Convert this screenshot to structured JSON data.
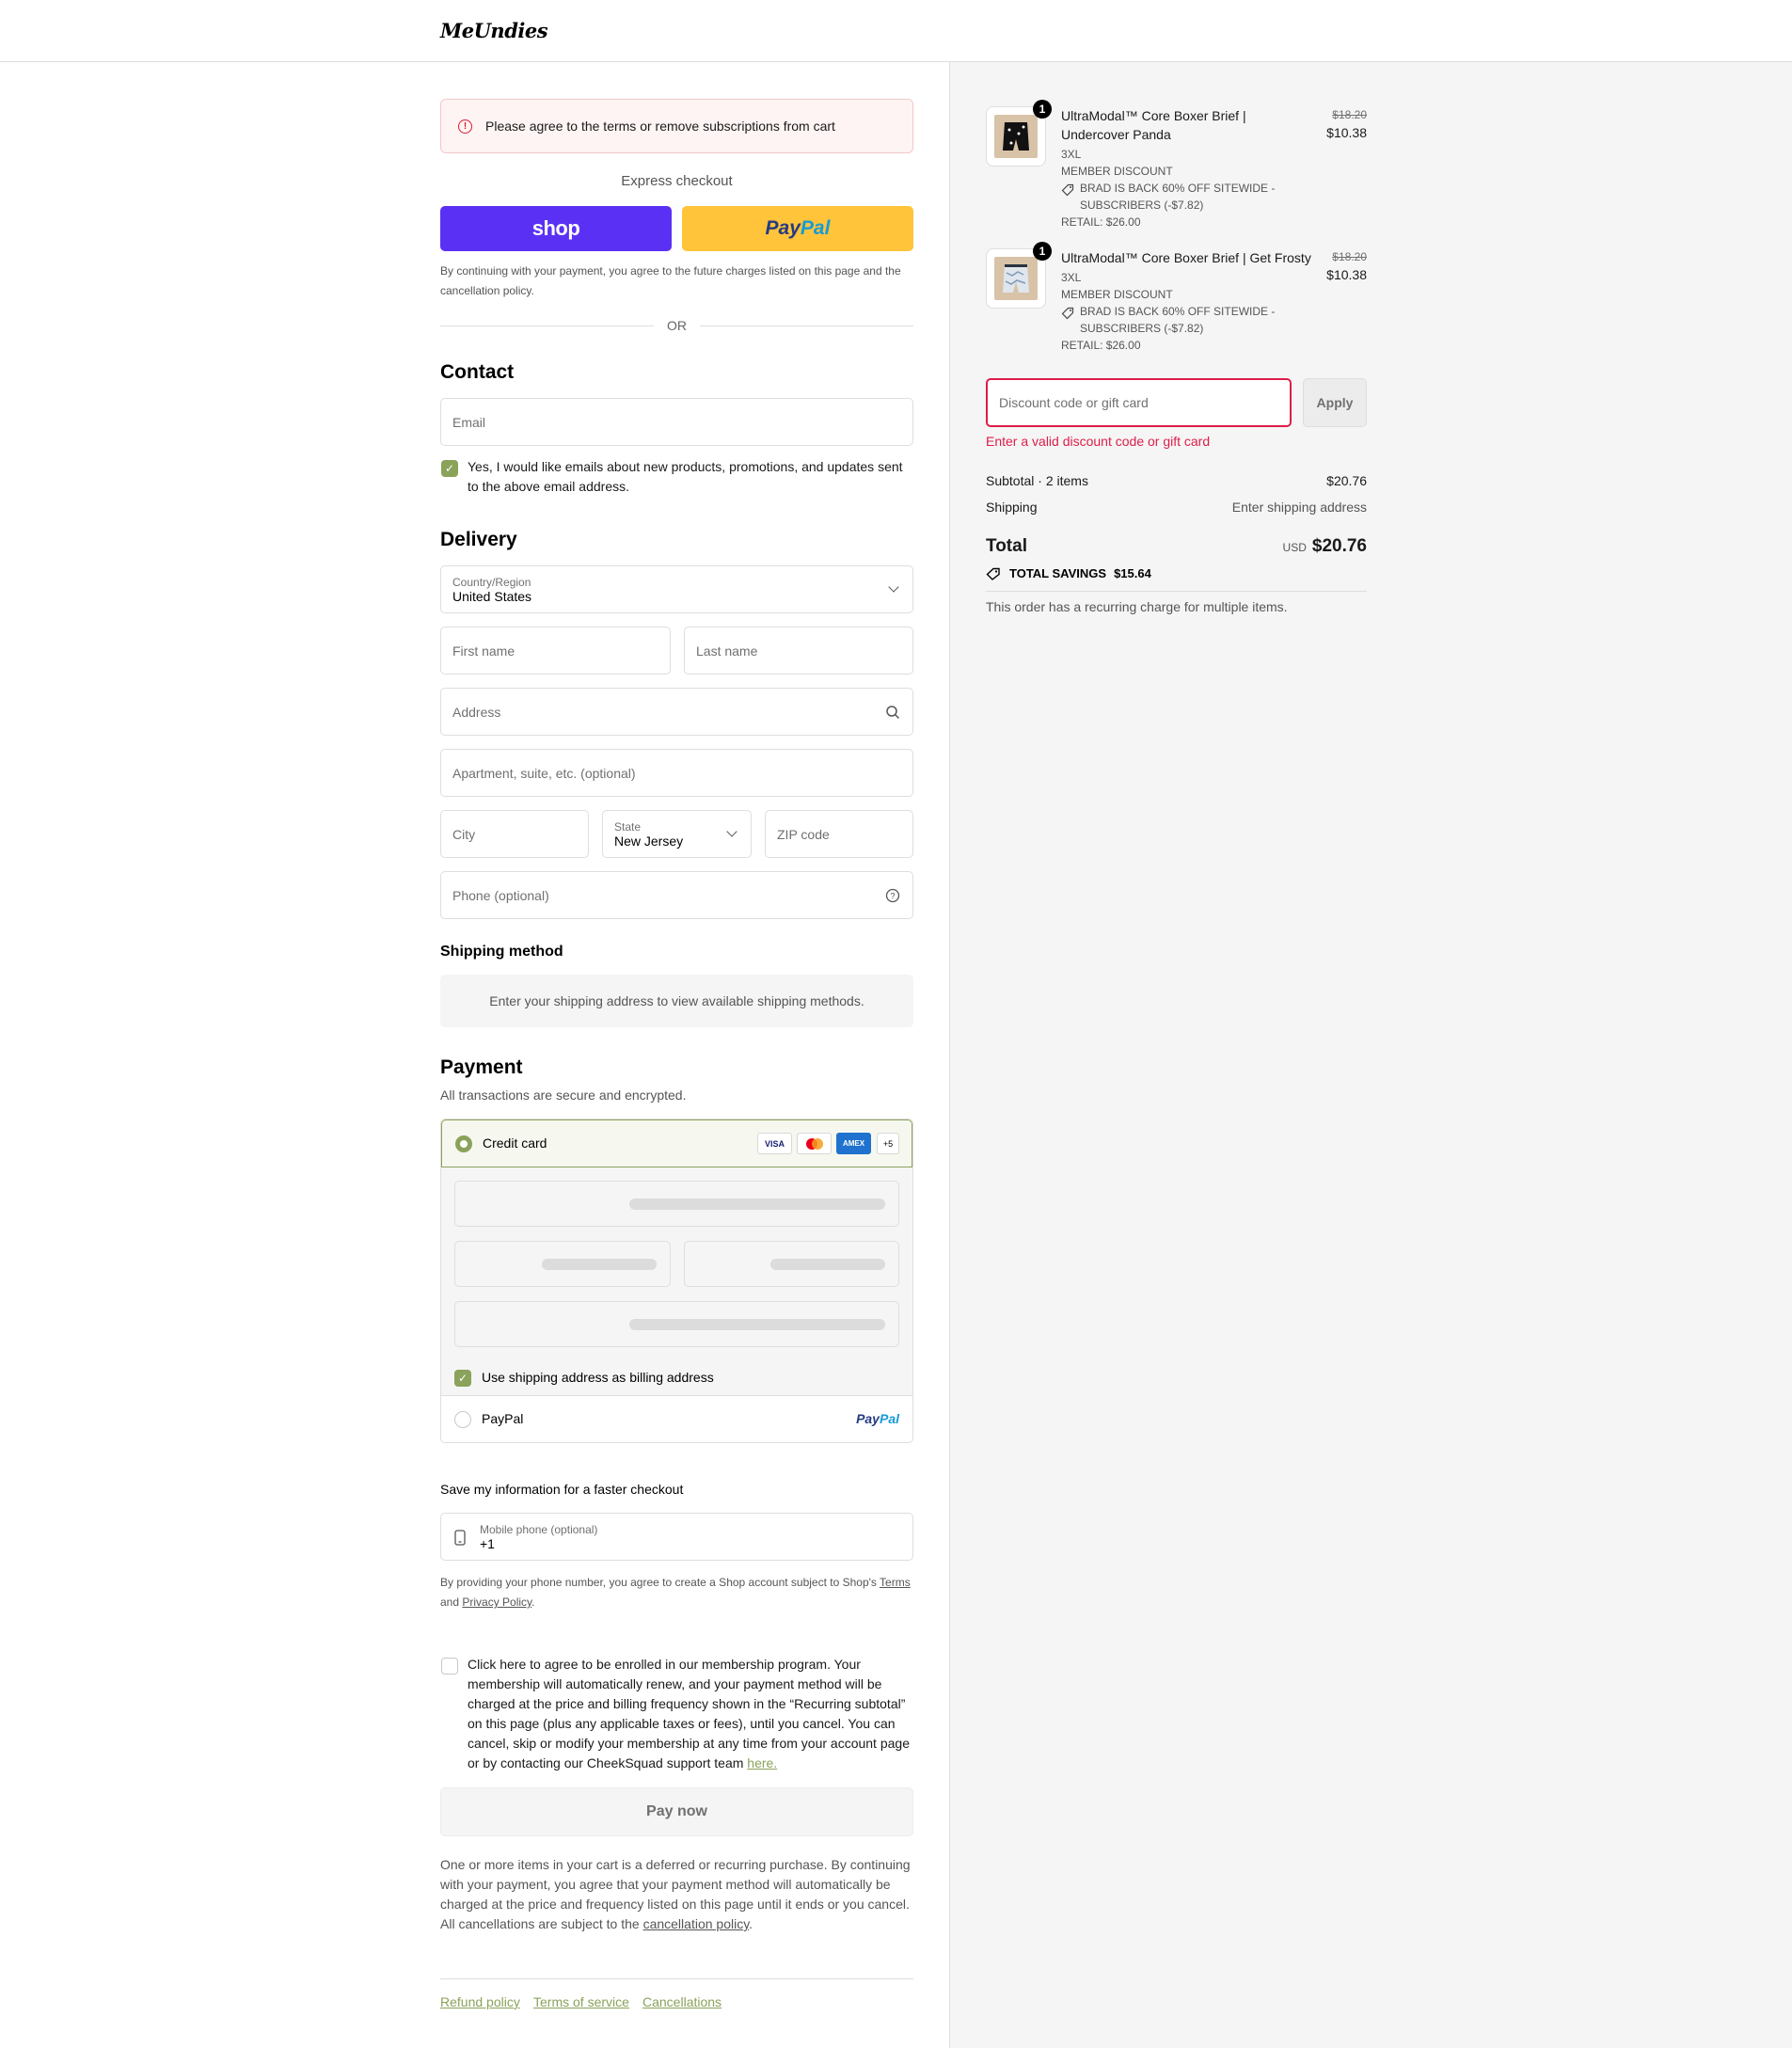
{
  "brand": {
    "logo": "MeUndies",
    "accent": "#8aa25a",
    "error": "#dd1d4a",
    "shop_purple": "#5a31f4",
    "paypal_yellow": "#ffc439"
  },
  "alert": {
    "icon": "alert-circle-icon",
    "message": "Please agree to the terms or remove subscriptions from cart"
  },
  "express": {
    "title": "Express checkout",
    "shop_label": "shop",
    "paypal_label_1": "Pay",
    "paypal_label_2": "Pal",
    "notice": "By continuing with your payment, you agree to the future charges listed on this page and the cancellation policy.",
    "or": "OR"
  },
  "contact": {
    "title": "Contact",
    "email_placeholder": "Email",
    "newsletter_checked": true,
    "newsletter_text": "Yes, I would like emails about new products, promotions, and updates sent to the above email address."
  },
  "delivery": {
    "title": "Delivery",
    "country_label": "Country/Region",
    "country_value": "United States",
    "first_name": "First name",
    "last_name": "Last name",
    "address": "Address",
    "apartment": "Apartment, suite, etc. (optional)",
    "city": "City",
    "state_label": "State",
    "state_value": "New Jersey",
    "zip": "ZIP code",
    "phone": "Phone (optional)"
  },
  "shipping_method": {
    "title": "Shipping method",
    "message": "Enter your shipping address to view available shipping methods."
  },
  "payment": {
    "title": "Payment",
    "subtitle": "All transactions are secure and encrypted.",
    "credit_card_label": "Credit card",
    "card_brands": [
      "VISA",
      "MC",
      "AMEX",
      "+5"
    ],
    "billing_same_checked": true,
    "billing_same_label": "Use shipping address as billing address",
    "paypal_label": "PayPal",
    "paypal_logo_1": "Pay",
    "paypal_logo_2": "Pal"
  },
  "save_info": {
    "title": "Save my information for a faster checkout",
    "mobile_label": "Mobile phone (optional)",
    "mobile_value": "+1",
    "notice_1": "By providing your phone number, you agree to create a Shop account subject to Shop's",
    "terms": "Terms",
    "and": "and",
    "privacy": "Privacy Policy",
    "period": "."
  },
  "membership": {
    "checked": false,
    "text": "Click here to agree to be enrolled in our membership program. Your membership will automatically renew, and your payment method will be charged at the price and billing frequency shown in the “Recurring subtotal” on this page (plus any applicable taxes or fees), until you cancel. You can cancel, skip or modify your membership at any time from your account page or by contacting our CheekSquad support team",
    "link": "here."
  },
  "pay_now": "Pay now",
  "recurring_notice": "One or more items in your cart is a deferred or recurring purchase. By continuing with your payment, you agree that your payment method will automatically be charged at the price and frequency listed on this page until it ends or you cancel. All cancellations are subject to the",
  "recurring_link": "cancellation policy",
  "footer": {
    "refund": "Refund policy",
    "terms": "Terms of service",
    "cancellations": "Cancellations"
  },
  "cart": {
    "items": [
      {
        "qty": "1",
        "name": "UltraModal™ Core Boxer Brief | Undercover Panda",
        "size": "3XL",
        "member": "MEMBER DISCOUNT",
        "promo": "BRAD IS BACK 60% OFF SITEWIDE - SUBSCRIBERS (-$7.82)",
        "retail": "RETAIL: $26.00",
        "orig_price": "$18.20",
        "price": "$10.38"
      },
      {
        "qty": "1",
        "name": "UltraModal™ Core Boxer Brief | Get Frosty",
        "size": "3XL",
        "member": "MEMBER DISCOUNT",
        "promo": "BRAD IS BACK 60% OFF SITEWIDE - SUBSCRIBERS (-$7.82)",
        "retail": "RETAIL: $26.00",
        "orig_price": "$18.20",
        "price": "$10.38"
      }
    ],
    "discount_placeholder": "Discount code or gift card",
    "apply": "Apply",
    "discount_error": "Enter a valid discount code or gift card",
    "subtotal_label": "Subtotal · 2 items",
    "subtotal_value": "$20.76",
    "shipping_label": "Shipping",
    "shipping_value": "Enter shipping address",
    "total_label": "Total",
    "currency": "USD",
    "total_value": "$20.76",
    "savings_label": "TOTAL SAVINGS",
    "savings_value": "$15.64",
    "recurring_note": "This order has a recurring charge for multiple items."
  }
}
